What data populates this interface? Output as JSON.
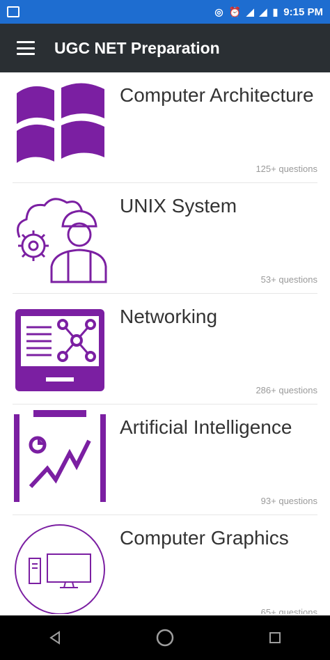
{
  "status_bar": {
    "time": "9:15 PM",
    "accent": "#1e6dd0"
  },
  "app_bar": {
    "title": "UGC NET Preparation",
    "menu_icon": "menu-icon",
    "background": "#2a2f33"
  },
  "topics": [
    {
      "title": "Computer Architecture",
      "count": "125+ questions",
      "icon": "windows-icon"
    },
    {
      "title": "UNIX System",
      "count": "53+ questions",
      "icon": "engineer-cloud-gear-icon"
    },
    {
      "title": "Networking",
      "count": "286+ questions",
      "icon": "network-monitor-icon"
    },
    {
      "title": "Artificial Intelligence",
      "count": "93+ questions",
      "icon": "analytics-clipboard-icon"
    },
    {
      "title": "Computer Graphics",
      "count": "65+ questions",
      "icon": "desktop-computer-icon"
    }
  ],
  "colors": {
    "purple": "#7b1fa2"
  },
  "nav_bar": {
    "back": "back-icon",
    "home": "home-icon",
    "recents": "recents-icon"
  }
}
